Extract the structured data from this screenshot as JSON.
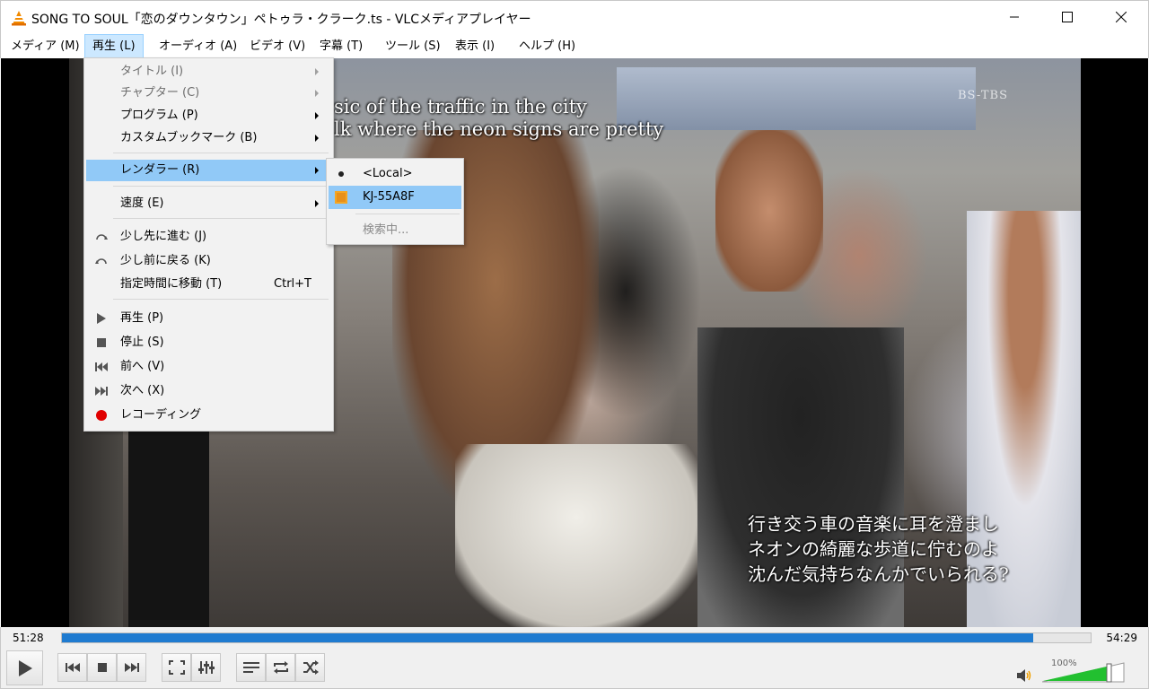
{
  "window": {
    "title": "SONG TO SOUL「恋のダウンタウン」ペトゥラ・クラーク.ts - VLCメディアプレイヤー"
  },
  "menubar": {
    "items": [
      {
        "label": "メディア (M)"
      },
      {
        "label": "再生 (L)"
      },
      {
        "label": "オーディオ (A)"
      },
      {
        "label": "ビデオ (V)"
      },
      {
        "label": "字幕 (T)"
      },
      {
        "label": "ツール (S)"
      },
      {
        "label": "表示 (I)"
      },
      {
        "label": "ヘルプ (H)"
      }
    ],
    "active_index": 1
  },
  "playback_menu": {
    "items": [
      {
        "label": "タイトル (I)"
      },
      {
        "label": "チャプター (C)"
      },
      {
        "label": "プログラム (P)"
      },
      {
        "label": "カスタムブックマーク (B)"
      },
      {
        "label": "レンダラー (R)"
      },
      {
        "label": "速度 (E)"
      },
      {
        "label": "少し先に進む (J)"
      },
      {
        "label": "少し前に戻る (K)"
      },
      {
        "label": "指定時間に移動 (T)",
        "shortcut": "Ctrl+T"
      },
      {
        "label": "再生 (P)"
      },
      {
        "label": "停止 (S)"
      },
      {
        "label": "前へ (V)"
      },
      {
        "label": "次へ (X)"
      },
      {
        "label": "レコーディング"
      }
    ]
  },
  "renderer_submenu": {
    "items": [
      {
        "label": "<Local>"
      },
      {
        "label": "KJ-55A8F"
      },
      {
        "label": "検索中..."
      }
    ]
  },
  "video": {
    "subtitle_en": [
      "sic of the traffic in the city",
      "lk where the neon signs are pretty"
    ],
    "subtitle_jp": [
      "行き交う車の音楽に耳を澄まし",
      "ネオンの綺麗な歩道に佇むのよ",
      "沈んだ気持ちなんかでいられる?"
    ],
    "channel_logo": "BS-TBS"
  },
  "player": {
    "time_elapsed": "51:28",
    "time_total": "54:29",
    "progress": 0.944,
    "volume_label": "100%",
    "volume_level": 1.0
  },
  "colors": {
    "menu_highlight": "#91c9f7",
    "seek_fill": "#1f7bd0",
    "record": "#e00000",
    "volume_green": "#22c030"
  }
}
